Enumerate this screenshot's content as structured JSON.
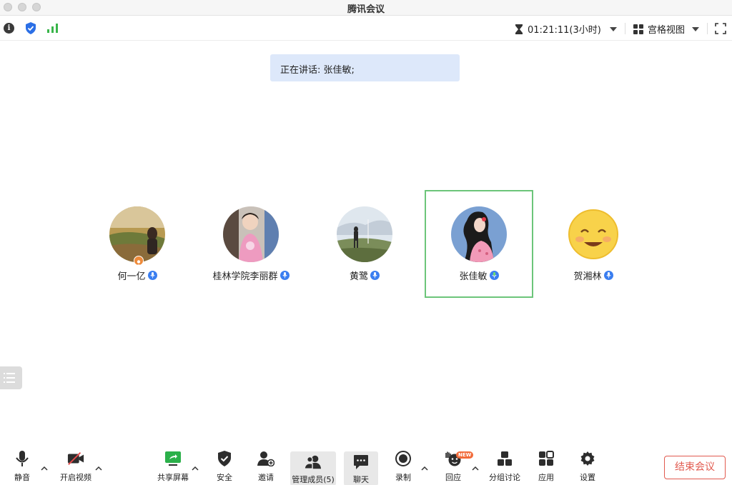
{
  "window": {
    "title": "腾讯会议"
  },
  "topbar": {
    "timer": "01:21:11(3小时)",
    "view_label": "宫格视图"
  },
  "speaking_banner": "正在讲话: 张佳敏;",
  "participants": [
    {
      "name": "何一亿",
      "host": true,
      "active": false
    },
    {
      "name": "桂林学院李丽群",
      "host": false,
      "active": false
    },
    {
      "name": "黄鹭",
      "host": false,
      "active": false
    },
    {
      "name": "张佳敏",
      "host": false,
      "active": true
    },
    {
      "name": "贺湘林",
      "host": false,
      "active": false
    }
  ],
  "toolbar": {
    "mute": "静音",
    "start_video": "开启视频",
    "share_screen": "共享屏幕",
    "security": "安全",
    "invite": "邀请",
    "manage_members": "管理成员(5)",
    "chat": "聊天",
    "record": "录制",
    "reactions": "回应",
    "reactions_badge": "NEW",
    "breakout": "分组讨论",
    "apps": "应用",
    "settings": "设置",
    "end_meeting": "结束会议"
  },
  "colors": {
    "accent_blue": "#3a7ef0",
    "active_border": "#6cc57a",
    "end_red": "#e25a4f",
    "banner_bg": "#dde8fa"
  },
  "icons": [
    "info-icon",
    "shield-icon",
    "signal-icon",
    "hourglass-icon",
    "grid-view-icon",
    "fullscreen-icon",
    "mic-icon",
    "video-off-icon",
    "share-screen-icon",
    "security-shield-icon",
    "invite-user-icon",
    "members-icon",
    "chat-icon",
    "record-icon",
    "raise-hand-icon",
    "breakout-icon",
    "apps-icon",
    "settings-gear-icon",
    "list-icon"
  ]
}
